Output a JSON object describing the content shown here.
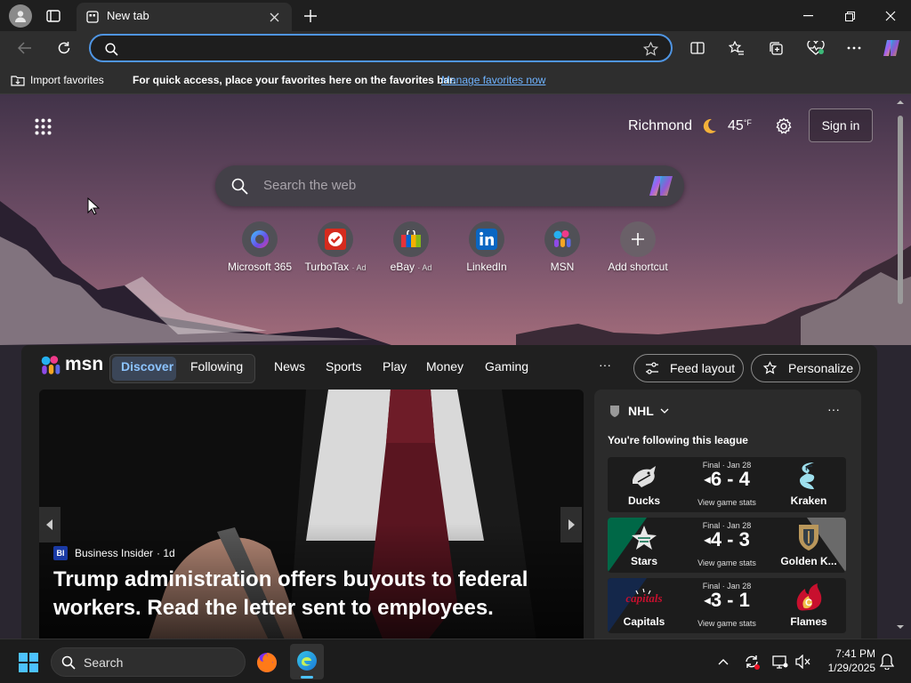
{
  "tab": {
    "title": "New tab"
  },
  "favorites_bar": {
    "import_label": "Import favorites",
    "message": "For quick access, place your favorites here on the favorites bar.",
    "manage_link": "Manage favorites now"
  },
  "newtab": {
    "location": "Richmond",
    "temperature": "45",
    "temp_unit": "°F",
    "sign_in": "Sign in",
    "search_placeholder": "Search the web",
    "shortcuts": [
      {
        "label": "Microsoft 365",
        "ad": ""
      },
      {
        "label": "TurboTax",
        "ad": "· Ad"
      },
      {
        "label": "eBay",
        "ad": "· Ad"
      },
      {
        "label": "LinkedIn",
        "ad": ""
      },
      {
        "label": "MSN",
        "ad": ""
      },
      {
        "label": "Add shortcut",
        "ad": ""
      }
    ]
  },
  "feed": {
    "brand": "msn",
    "tabs": [
      "Discover",
      "Following",
      "News",
      "Sports",
      "Play",
      "Money",
      "Gaming"
    ],
    "more": "···",
    "feed_layout": "Feed layout",
    "personalize": "Personalize",
    "hero": {
      "source_badge": "BI",
      "source": "Business Insider",
      "age": "· 1d",
      "headline": "Trump administration offers buyouts to federal workers. Read the letter sent to employees."
    },
    "nhl": {
      "title": "NHL",
      "subtitle": "You're following this league",
      "more": "···",
      "games": [
        {
          "status": "Final · Jan 28",
          "home": "Ducks",
          "away": "Kraken",
          "score": "6 - 4",
          "stats": "View game stats"
        },
        {
          "status": "Final · Jan 28",
          "home": "Stars",
          "away": "Golden K...",
          "score": "4 - 3",
          "stats": "View game stats"
        },
        {
          "status": "Final · Jan 28",
          "home": "Capitals",
          "away": "Flames",
          "score": "3 - 1",
          "stats": "View game stats"
        }
      ]
    }
  },
  "taskbar": {
    "search_label": "Search",
    "time": "7:41 PM",
    "date": "1/29/2025"
  },
  "colors": {
    "accent": "#4f95e3",
    "link": "#6fb3ff",
    "titlebar": "#1f1f1f",
    "toolbar": "#2e2e2e"
  }
}
